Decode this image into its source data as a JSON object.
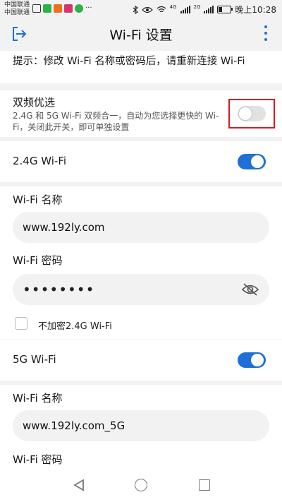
{
  "status_bar": {
    "carrier_1": "中国联通",
    "carrier_2": "中国联通",
    "net_1": "4G",
    "net_2": "2G",
    "time": "晚上10:28"
  },
  "header": {
    "title": "Wi-Fi 设置",
    "back_icon": "exit-icon",
    "menu_icon": "more-vertical-icon"
  },
  "tip": "提示：修改 Wi-Fi 名称或密码后，请重新连接 Wi-Fi",
  "dual_band": {
    "title": "双频优选",
    "description": "2.4G 和 5G Wi-Fi 双频合一，自动为您选择更快的 Wi-Fi，关闭此开关，即可单独设置",
    "enabled": false
  },
  "band_24": {
    "label": "2.4G Wi-Fi",
    "enabled": true,
    "name_label": "Wi-Fi 名称",
    "name_value": "www.192ly.com",
    "password_label": "Wi-Fi 密码",
    "password_value": "••••••••",
    "no_password_label": "不加密2.4G Wi-Fi"
  },
  "band_5": {
    "label": "5G Wi-Fi",
    "enabled": true,
    "name_label": "Wi-Fi 名称",
    "name_value": "www.192ly.com_5G",
    "password_label": "Wi-Fi 密码"
  },
  "colors": {
    "accent": "#1f6fd6",
    "highlight_border": "#d7191f"
  }
}
